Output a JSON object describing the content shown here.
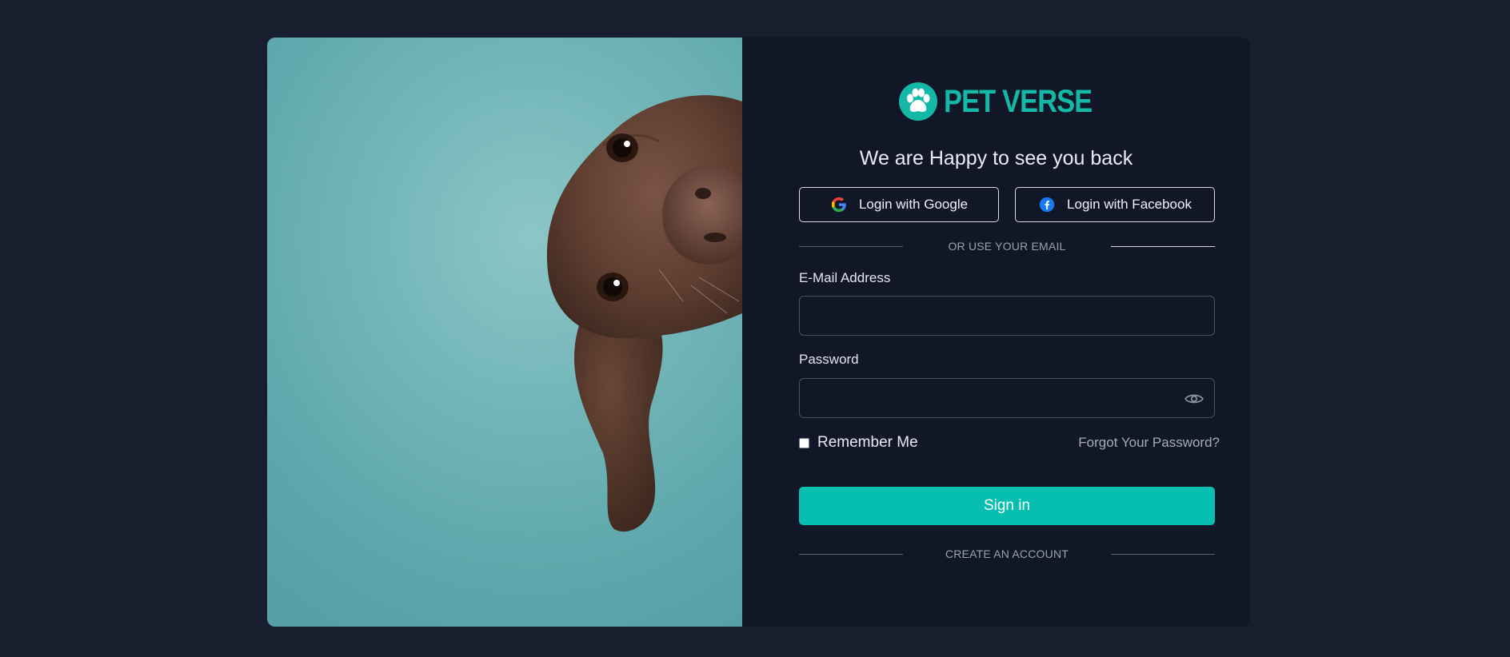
{
  "brand": {
    "name": "PET VERSE",
    "logo_icon": "paw-icon",
    "color": "#14b8a6"
  },
  "heading": "We are Happy to see you back",
  "social": {
    "google_label": "Login with Google",
    "google_icon": "google-icon",
    "facebook_label": "Login with Facebook",
    "facebook_icon": "facebook-icon"
  },
  "divider_email": "OR USE YOUR EMAIL",
  "email": {
    "label": "E-Mail Address",
    "value": "",
    "placeholder": ""
  },
  "password": {
    "label": "Password",
    "value": "",
    "placeholder": "",
    "toggle_icon": "eye-icon"
  },
  "remember_label": "Remember Me",
  "forgot_label": "Forgot Your Password?",
  "signin_label": "Sign in",
  "create_account_label": "CREATE AN ACCOUNT",
  "colors": {
    "page_bg": "#191e2e",
    "card_bg": "#121728",
    "accent": "#06bfb1",
    "photo_bg": "#72b5b8"
  }
}
